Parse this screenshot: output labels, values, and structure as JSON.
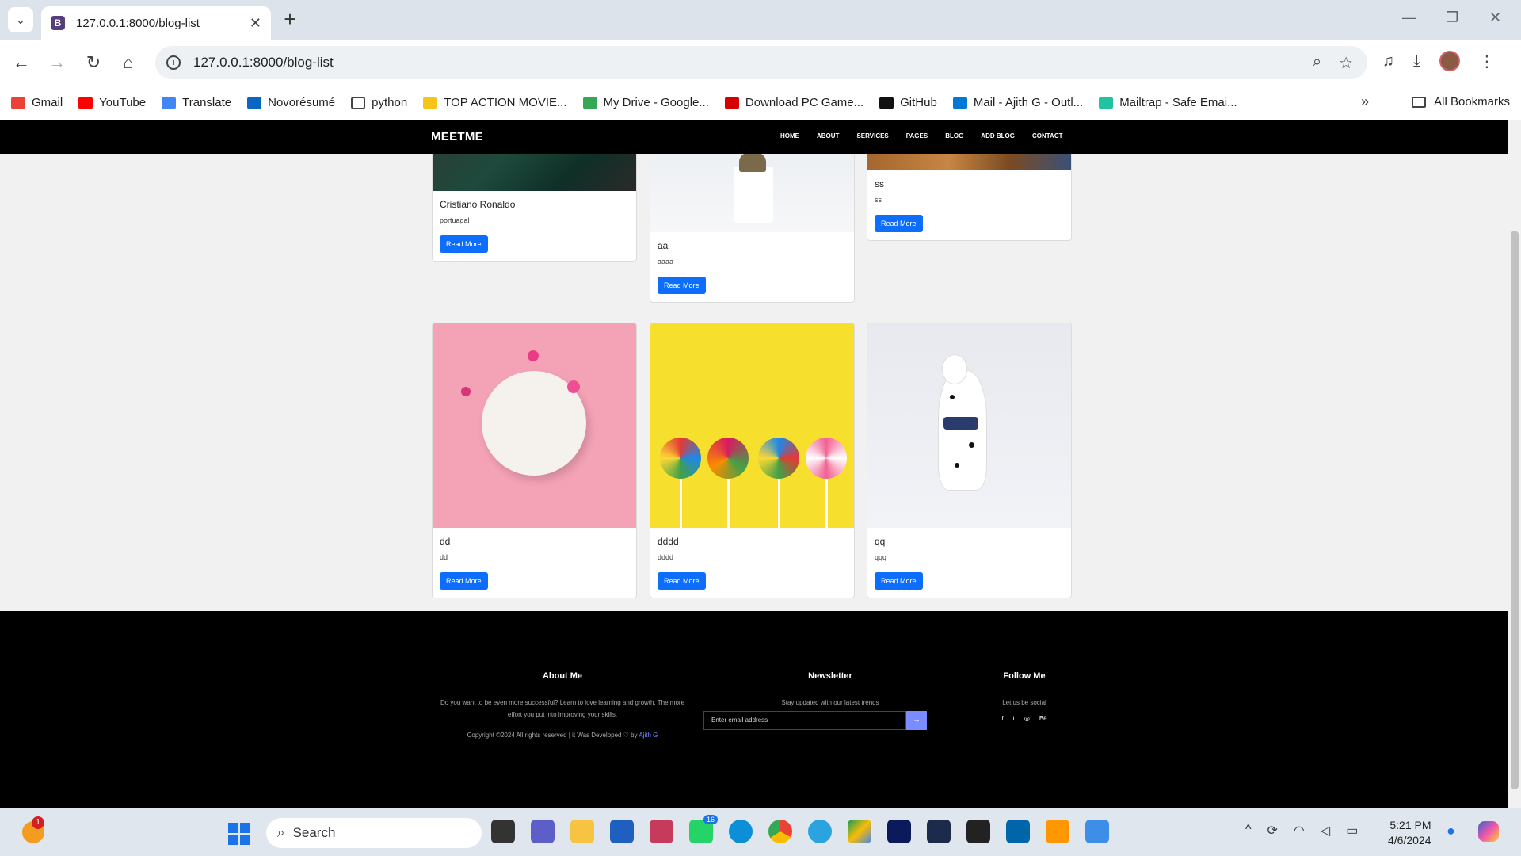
{
  "browser": {
    "tab_title": "127.0.0.1:8000/blog-list",
    "favicon_letter": "B",
    "url": "127.0.0.1:8000/blog-list",
    "bookmarks": [
      {
        "label": "Gmail",
        "color": "#ea4335"
      },
      {
        "label": "YouTube",
        "color": "#ff0000"
      },
      {
        "label": "Translate",
        "color": "#4285f4"
      },
      {
        "label": "Novorésumé",
        "color": "#0a66c2"
      },
      {
        "label": "python",
        "color": "#ffffff"
      },
      {
        "label": "TOP ACTION MOVIE...",
        "color": "#f5c518"
      },
      {
        "label": "My Drive - Google...",
        "color": "#34a853"
      },
      {
        "label": "Download PC Game...",
        "color": "#d50000"
      },
      {
        "label": "GitHub",
        "color": "#111111"
      },
      {
        "label": "Mail - Ajith G - Outl...",
        "color": "#0078d4"
      },
      {
        "label": "Mailtrap - Safe Emai...",
        "color": "#22c3a0"
      }
    ],
    "all_bookmarks": "All Bookmarks"
  },
  "site": {
    "brand": "MEETME",
    "nav": [
      "HOME",
      "ABOUT",
      "SERVICES",
      "PAGES",
      "BLOG",
      "ADD BLOG",
      "CONTACT"
    ]
  },
  "posts": [
    {
      "title": "Cristiano Ronaldo",
      "text": "portuagal",
      "button": "Read More"
    },
    {
      "title": "aa",
      "text": "aaaa",
      "button": "Read More"
    },
    {
      "title": "ss",
      "text": "ss",
      "button": "Read More"
    },
    {
      "title": "dd",
      "text": "dd",
      "button": "Read More"
    },
    {
      "title": "dddd",
      "text": "dddd",
      "button": "Read More"
    },
    {
      "title": "qq",
      "text": "qqq",
      "button": "Read More"
    }
  ],
  "footer": {
    "about_head": "About Me",
    "about_text": "Do you want to be even more successful? Learn to love learning and growth. The more effort you put into improving your skills,",
    "copyright": "Copyright ©2024 All rights reserved | it Was Developed ♡ by",
    "author": "Ajith G",
    "news_head": "Newsletter",
    "news_text": "Stay updated with our latest trends",
    "news_placeholder": "Enter email address",
    "follow_head": "Follow Me",
    "follow_text": "Let us be social",
    "social": [
      "f",
      "t",
      "◎",
      "Bē"
    ]
  },
  "taskbar": {
    "search": "Search",
    "weather_badge": "1",
    "time": "5:21 PM",
    "date": "4/6/2024",
    "whatsapp_badge": "16"
  }
}
